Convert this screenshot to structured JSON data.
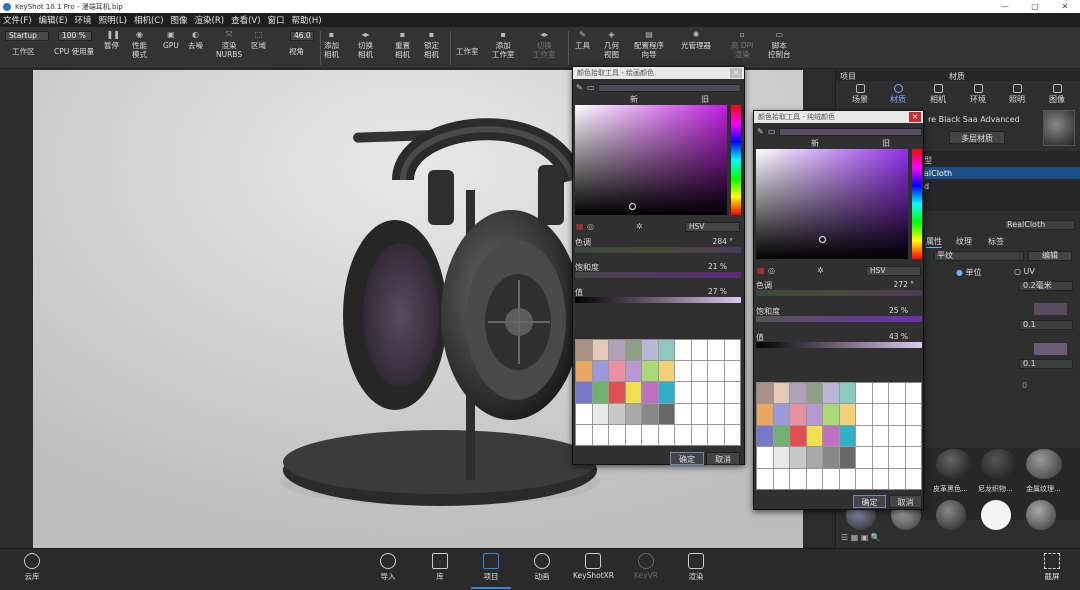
{
  "window": {
    "title": "KeyShot 10.1 Pro - 漫端耳机.bip",
    "controls": [
      "—",
      "□",
      "✕"
    ]
  },
  "menu": [
    "文件(F)",
    "编辑(E)",
    "环境",
    "照明(L)",
    "相机(C)",
    "图像",
    "渲染(R)",
    "查看(V)",
    "窗口",
    "帮助(H)"
  ],
  "toolbar": {
    "workspace_select": "Startup",
    "zoom_value": "100 %",
    "fov_value": "46.0",
    "items": [
      {
        "label": "工作区",
        "icon": "workspace-icon"
      },
      {
        "label": "CPU 使用量",
        "icon": "cpu-icon"
      },
      {
        "label": "暂停",
        "icon": "pause-icon"
      },
      {
        "label": "性能\n模式",
        "icon": "performance-icon"
      },
      {
        "label": "GPU",
        "icon": "gpu-icon"
      },
      {
        "label": "去噪",
        "icon": "denoise-icon"
      },
      {
        "label": "渲染\nNURBS",
        "icon": "nurbs-icon"
      },
      {
        "label": "区域",
        "icon": "region-icon"
      },
      {
        "label": "视角",
        "icon": "view-icon"
      },
      {
        "label": "添加\n相机",
        "icon": "add-camera-icon"
      },
      {
        "label": "切换\n相机",
        "icon": "switch-camera-icon"
      },
      {
        "label": "重置\n相机",
        "icon": "reset-camera-icon"
      },
      {
        "label": "锁定\n相机",
        "icon": "lock-camera-icon"
      },
      {
        "label": "工作室",
        "icon": "studio-icon"
      },
      {
        "label": "添加\n工作室",
        "icon": "add-studio-icon"
      },
      {
        "label": "切换\n工作室",
        "icon": "switch-studio-icon"
      },
      {
        "label": "工具",
        "icon": "tools-icon"
      },
      {
        "label": "几何\n视图",
        "icon": "geometry-view-icon"
      },
      {
        "label": "配置程序\n向导",
        "icon": "configurator-icon"
      },
      {
        "label": "光管理器",
        "icon": "light-manager-icon"
      },
      {
        "label": "高 DPI\n渲染",
        "icon": "hidpi-icon"
      },
      {
        "label": "脚本\n控制台",
        "icon": "script-console-icon"
      }
    ]
  },
  "right_panel": {
    "header_left": "项目",
    "header_center": "材质",
    "tabs": [
      "场景",
      "材质",
      "相机",
      "环境",
      "照明",
      "图像"
    ],
    "material_name": "re Black Saa Advanced",
    "multilayer_button": "多层材质",
    "tree_item_1": "型",
    "tree_item_selected": "alCloth",
    "tree_item_3": "d",
    "type_field": "RealCloth",
    "subtabs": [
      "属性",
      "纹理",
      "标签"
    ],
    "weave_type": "平纹",
    "edit_button": "编辑",
    "unit_radio": "单位",
    "uv_radio": "UV",
    "size_value": "0.2毫米",
    "value_1": "0.1",
    "value_2": "0.1",
    "value_3": "0",
    "library_labels": [
      "皮革黑色...",
      "尼龙织物...",
      "金属纹理..."
    ]
  },
  "color_picker_1": {
    "title": "颜色拾取工具 - 绘画颜色",
    "new_label": "新",
    "old_label": "旧",
    "mode": "HSV",
    "hue_label": "色调",
    "hue_value": "284 °",
    "saturation_label": "饱和度",
    "saturation_value": "21 %",
    "value_label": "值",
    "value_value": "27 %",
    "ok": "确定",
    "cancel": "取消"
  },
  "color_picker_2": {
    "title": "颜色拾取工具 - 纯绒颜色",
    "new_label": "新",
    "old_label": "旧",
    "mode": "HSV",
    "hue_label": "色调",
    "hue_value": "272 °",
    "saturation_label": "饱和度",
    "saturation_value": "25 %",
    "value_label": "值",
    "value_value": "43 %",
    "ok": "确定",
    "cancel": "取消"
  },
  "swatches": {
    "row1": [
      "#a89085",
      "#e5c9b8",
      "#b0a0b8",
      "#8fa088",
      "#b8b8d8",
      "#8cc8c0",
      "#ffffff",
      "#ffffff",
      "#ffffff",
      "#ffffff"
    ],
    "row2": [
      "#e8a860",
      "#9a9ad8",
      "#e890a0",
      "#b898d0",
      "#a8d878",
      "#f0d078",
      "#ffffff",
      "#ffffff",
      "#ffffff",
      "#ffffff"
    ],
    "row3": [
      "#7878c8",
      "#70b070",
      "#e05050",
      "#f0e050",
      "#c070c0",
      "#30b0c8",
      "#ffffff",
      "#ffffff",
      "#ffffff",
      "#ffffff"
    ],
    "row4": [
      "#ffffff",
      "#e8e8e8",
      "#c8c8c8",
      "#a8a8a8",
      "#888888",
      "#686868",
      "#ffffff",
      "#ffffff",
      "#ffffff",
      "#ffffff"
    ]
  },
  "bottom_bar": {
    "cloud_library": "云库",
    "import": "导入",
    "library": "库",
    "project": "项目",
    "animation": "动画",
    "keyshotxr": "KeyShotXR",
    "keyvr": "KeyVR",
    "render": "渲染",
    "screenshot": "截屏"
  }
}
